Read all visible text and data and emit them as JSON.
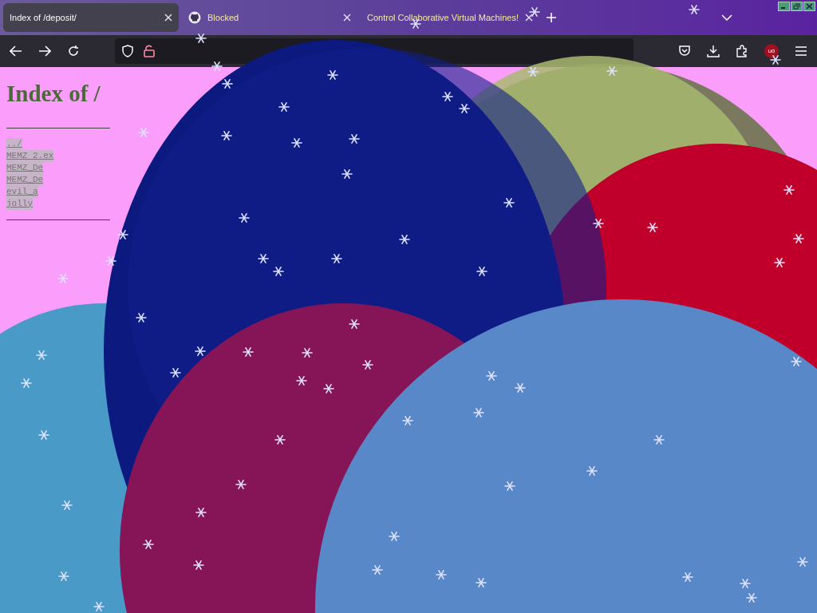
{
  "tabs": [
    {
      "title": "Index of /deposit/",
      "selected": true,
      "kind": "plain"
    },
    {
      "title": "Blocked",
      "selected": false,
      "kind": "github"
    },
    {
      "title": "Control Collaborative Virtual Machines!",
      "selected": false,
      "kind": "plain"
    }
  ],
  "toolbar": {
    "addon_badge": "uo"
  },
  "page": {
    "heading": "Index of /",
    "entries": [
      "../",
      "MEMZ 2.ex",
      "MEMZ_De",
      "MEMZ_De",
      "evil_a",
      "jolly"
    ]
  }
}
